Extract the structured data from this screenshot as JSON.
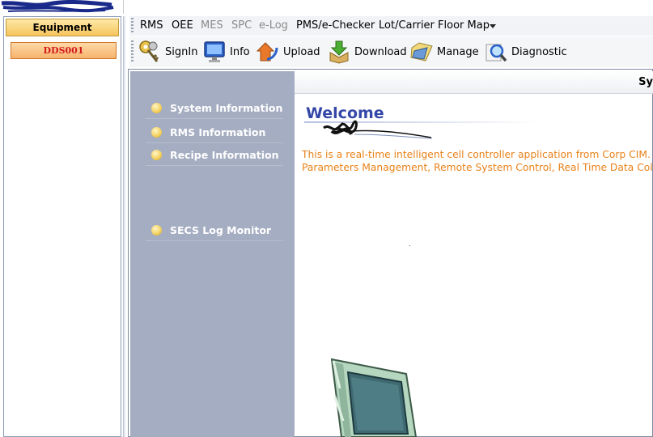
{
  "equipment": {
    "header": "Equipment",
    "items": [
      "DDS001"
    ]
  },
  "menu": {
    "items": [
      {
        "label": "RMS",
        "enabled": true
      },
      {
        "label": "OEE",
        "enabled": true
      },
      {
        "label": "MES",
        "enabled": false
      },
      {
        "label": "SPC",
        "enabled": false
      },
      {
        "label": "e-Log",
        "enabled": false
      },
      {
        "label": "PMS/e-Checker",
        "enabled": true
      },
      {
        "label": "Lot/Carrier Floor Map",
        "enabled": true
      }
    ],
    "overflow_icon": "dropdown-arrow-icon"
  },
  "toolbar": {
    "signin": {
      "label": "SignIn",
      "icon": "key-icon"
    },
    "info": {
      "label": "Info",
      "icon": "monitor-icon"
    },
    "upload": {
      "label": "Upload",
      "icon": "upload-arrow-icon"
    },
    "download": {
      "label": "Download",
      "icon": "download-box-icon"
    },
    "manage": {
      "label": "Manage",
      "icon": "manage-folder-icon"
    },
    "diagnostic": {
      "label": "Diagnostic",
      "icon": "magnifier-icon"
    }
  },
  "nav": {
    "items": [
      "System Information",
      "RMS Information",
      "Recipe Information",
      "SECS Log Monitor"
    ]
  },
  "content": {
    "title_bar": "Sy",
    "welcome": "Welcome",
    "description_line1": "This is a real-time intelligent cell controller application from Corp CIM. The c",
    "description_line2": "Parameters Management, Remote System Control, Real Time Data Collectio"
  },
  "colors": {
    "accent_orange": "#f6c45c",
    "equipment_text": "#d21a1a",
    "welcome_blue": "#3447a8",
    "description_orange": "#e8821a",
    "nav_panel": "#a5adc2"
  }
}
